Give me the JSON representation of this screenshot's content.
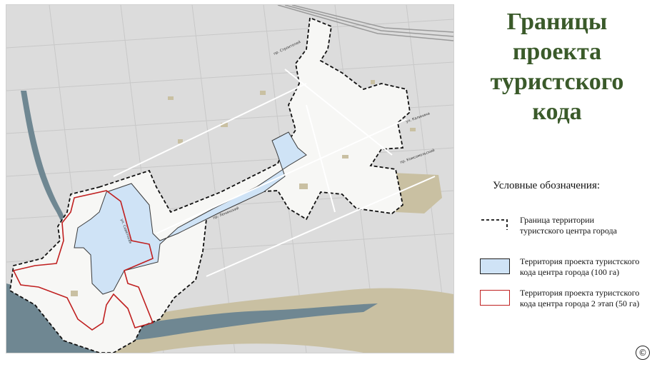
{
  "title_lines": [
    "Границы",
    "проекта",
    "туристского",
    "кода"
  ],
  "legend": {
    "heading": "Условные обозначения:",
    "items": [
      {
        "name": "boundary",
        "lines": [
          "Граница территории",
          "туристского центра города"
        ]
      },
      {
        "name": "blue-zone",
        "lines": [
          "Территория проекта туристского",
          "кода центра города (100 га)"
        ]
      },
      {
        "name": "red-zone",
        "lines": [
          "Территория проекта туристского",
          "кода центра города 2 этап (50 га)"
        ]
      }
    ]
  },
  "copyright": "©",
  "colors": {
    "title": "#3a5a2a",
    "map_bg": "#d9d9d9",
    "river": "#6f8792",
    "sand": "#c9c0a2",
    "blue_zone": "#cfe3f6",
    "red_zone": "#c02020"
  },
  "map_labels": {
    "stroiteley": "пр. Строителей",
    "kalinina": "ул. Калинина",
    "komsomolskiy": "пр. Комсомольский",
    "leninskiy": "пр. Ленинский",
    "sovetskiy": "ул. Советская"
  }
}
